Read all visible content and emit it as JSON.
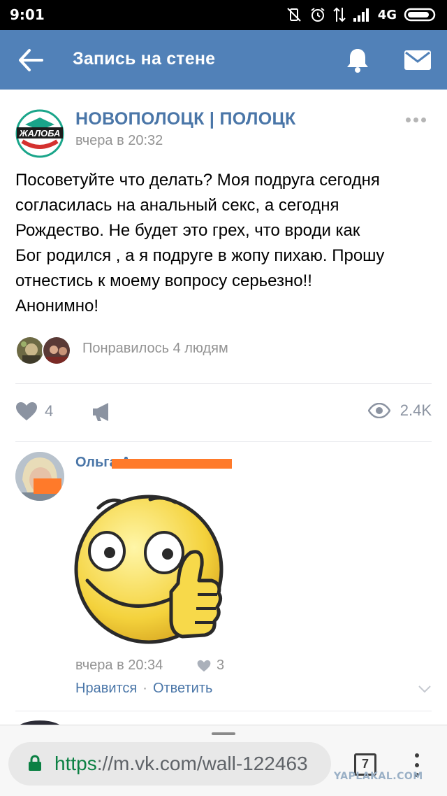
{
  "status_bar": {
    "time": "9:01",
    "network": "4G"
  },
  "header": {
    "title": "Запись на стене",
    "back_icon": "arrow-left-icon",
    "bell_icon": "bell-icon",
    "mail_icon": "envelope-icon",
    "background": "#5181b8"
  },
  "post": {
    "group_name": "НОВОПОЛОЦК | ПОЛОЦК",
    "group_logo_text": "ЖАЛОБА",
    "time": "вчера в 20:32",
    "text": "Посоветуйте что делать? Моя подруга сегодня\nсогласилась на анальный секс, а сегодня\nРождество. Не будет это грех, что вроди как\nБог родился , а я подруге в жопу пихаю. Прошу\nотнестись к моему вопросу серьезно!!\nАнонимно!",
    "likes_summary": "Понравилось 4 людям",
    "like_count": "4",
    "views": "2.4K"
  },
  "comment": {
    "author": "Ольга А",
    "time": "вчера в 20:34",
    "likes": "3",
    "like_label": "Нравится",
    "separator": "·",
    "reply_label": "Ответить",
    "sticker": "smiley-thumbs-up-sticker"
  },
  "browser": {
    "url_scheme": "https",
    "url_rest": "://m.vk.com/wall-122463",
    "tab_count": "7"
  },
  "watermark": "YAPLAKAL.COM",
  "colors": {
    "link": "#4a76a8",
    "muted": "#939393",
    "icon_gray": "#8b93a1",
    "secure_green": "#0b8043",
    "redaction": "#ff7a2a"
  }
}
